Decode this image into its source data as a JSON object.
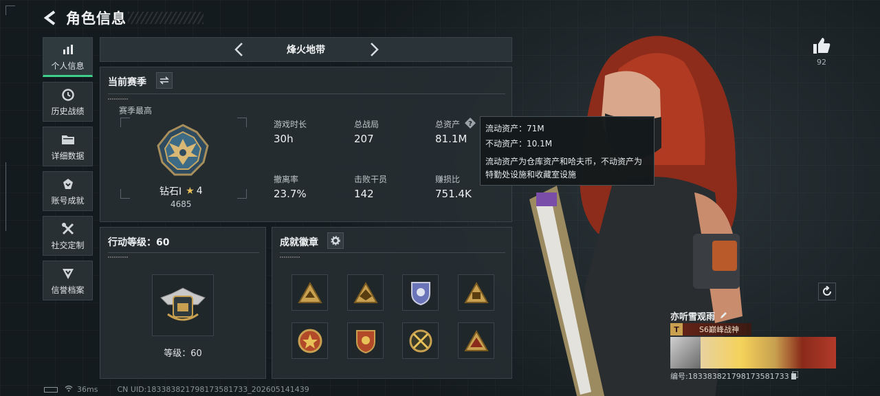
{
  "header": {
    "title": "角色信息"
  },
  "sidebar": {
    "items": [
      {
        "label": "个人信息",
        "icon": "bar-chart-icon",
        "active": true
      },
      {
        "label": "历史战绩",
        "icon": "history-icon"
      },
      {
        "label": "详细数据",
        "icon": "folder-icon"
      },
      {
        "label": "账号成就",
        "icon": "achievement-icon"
      },
      {
        "label": "社交定制",
        "icon": "tools-icon"
      },
      {
        "label": "信誉档案",
        "icon": "shield-icon"
      }
    ]
  },
  "mode": {
    "name": "烽火地带"
  },
  "season": {
    "title": "当前赛季",
    "best_label": "赛季最高",
    "rank_name": "钻石I",
    "rank_stars": "4",
    "rank_points": "4685",
    "stats": [
      {
        "label": "游戏时长",
        "value": "30h"
      },
      {
        "label": "总战局",
        "value": "207"
      },
      {
        "label": "总资产",
        "value": "81.1M"
      },
      {
        "label": "撤离率",
        "value": "23.7%"
      },
      {
        "label": "击败干员",
        "value": "142"
      },
      {
        "label": "赚损比",
        "value": "751.4K"
      }
    ]
  },
  "tooltip": {
    "liquid": "流动资产：71M",
    "fixed": "不动资产：10.1M",
    "desc": "流动资产为仓库资产和哈夫币，不动资产为特勤处设施和收藏室设施"
  },
  "action_level": {
    "title": "行动等级：60",
    "level_text": "等级：60"
  },
  "badges": {
    "title": "成就徽章"
  },
  "profile": {
    "likes": "92",
    "nickname": "亦听雪观雨",
    "rank_title": "S6巅峰战神",
    "id_text": "编号:18338382179817358173​3"
  },
  "footer": {
    "ping": "36ms",
    "uid": "CN UID:18338382179817358173​3_202605141439"
  },
  "colors": {
    "accent": "#3fd18a",
    "gold": "#c8a050",
    "tooltip_bg": "#141a1c"
  }
}
